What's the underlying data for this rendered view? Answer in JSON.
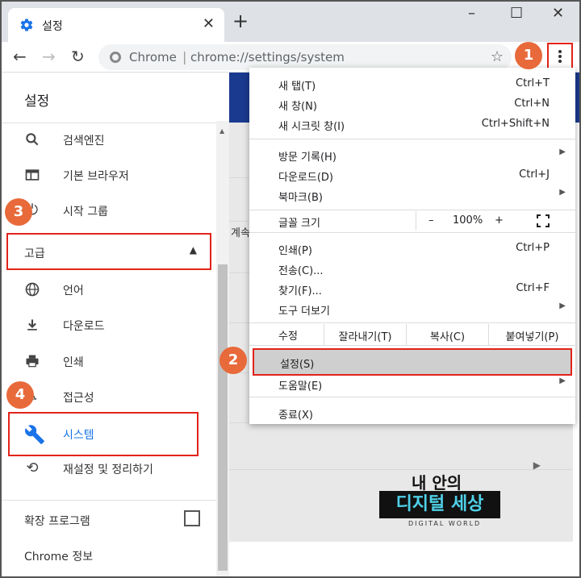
{
  "window": {
    "tab_title": "설정",
    "tab_close": "✕",
    "new_tab": "+",
    "minimize": "–",
    "maximize": "☐",
    "close": "✕"
  },
  "toolbar": {
    "site_label": "Chrome",
    "separator": "|",
    "url": "chrome://settings/system"
  },
  "sidebar": {
    "heading": "설정",
    "items": [
      {
        "label": "검색엔진",
        "icon": "search-icon"
      },
      {
        "label": "기본 브라우저",
        "icon": "browser-icon"
      },
      {
        "label": "시작 그룹",
        "icon": "power-icon"
      },
      {
        "label": "고급",
        "icon": "caret-up-icon"
      },
      {
        "label": "언어",
        "icon": "globe-icon"
      },
      {
        "label": "다운로드",
        "icon": "download-icon"
      },
      {
        "label": "인쇄",
        "icon": "printer-icon"
      },
      {
        "label": "접근성",
        "icon": "accessibility-icon"
      },
      {
        "label": "시스템",
        "icon": "wrench-icon"
      },
      {
        "label": "재설정 및 정리하기",
        "icon": "restore-icon"
      }
    ],
    "extensions": "확장 프로그램",
    "about": "Chrome 정보"
  },
  "main": {
    "cut_text": "계속"
  },
  "menu": {
    "new_tab": {
      "label": "새 탭(T)",
      "shortcut": "Ctrl+T"
    },
    "new_window": {
      "label": "새 창(N)",
      "shortcut": "Ctrl+N"
    },
    "incognito": {
      "label": "새 시크릿 창(I)",
      "shortcut": "Ctrl+Shift+N"
    },
    "history": {
      "label": "방문 기록(H)"
    },
    "downloads": {
      "label": "다운로드(D)",
      "shortcut": "Ctrl+J"
    },
    "bookmarks": {
      "label": "북마크(B)"
    },
    "zoom": {
      "label": "글꼴 크기",
      "minus": "–",
      "value": "100%",
      "plus": "+"
    },
    "print": {
      "label": "인쇄(P)",
      "shortcut": "Ctrl+P"
    },
    "cast": {
      "label": "전송(C)..."
    },
    "find": {
      "label": "찾기(F)...",
      "shortcut": "Ctrl+F"
    },
    "more_tools": {
      "label": "도구 더보기"
    },
    "edit": {
      "label": "수정",
      "cut": "잘라내기(T)",
      "copy": "복사(C)",
      "paste": "붙여넣기(P)"
    },
    "settings": {
      "label": "설정(S)"
    },
    "help": {
      "label": "도움말(E)"
    },
    "exit": {
      "label": "종료(X)"
    }
  },
  "badges": [
    "1",
    "2",
    "3",
    "4"
  ],
  "watermark": {
    "line1": "내 안의",
    "line2": "디지털 세상",
    "line3": "DIGITAL WORLD"
  },
  "colors": {
    "highlight_border": "#e2231a",
    "badge": "#e8693a",
    "accent_blue": "#1a73e8"
  }
}
